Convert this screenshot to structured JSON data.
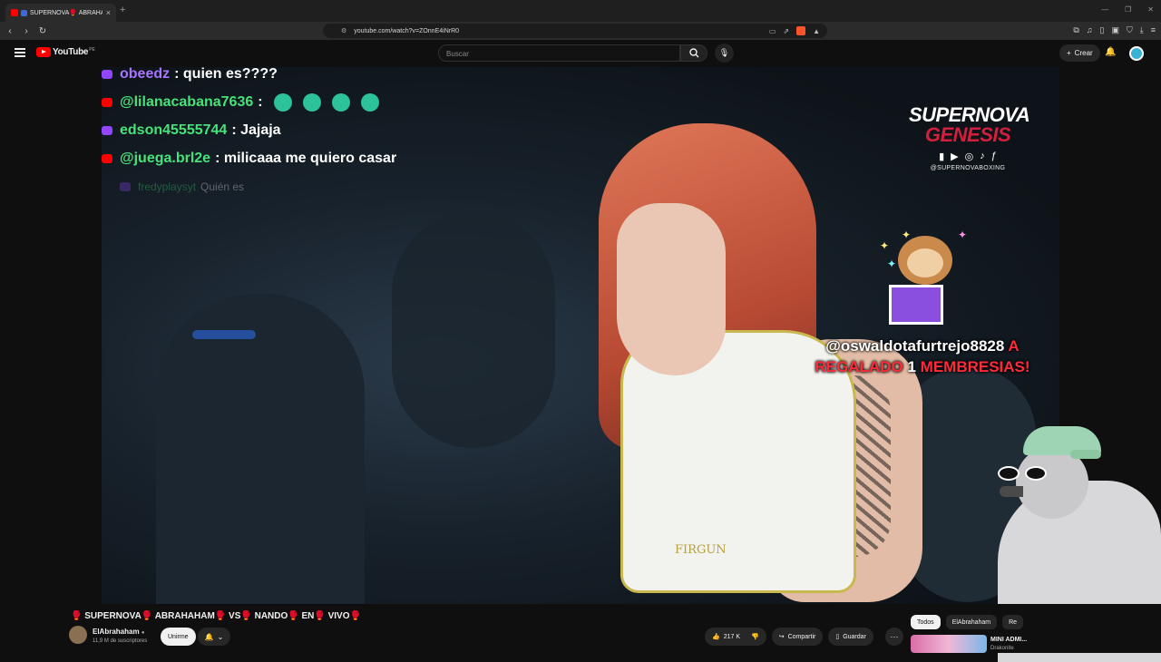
{
  "browser": {
    "tab_title": "SUPERNOVA🥊 ABRAHAH...",
    "tab_close": "×",
    "new_tab": "+",
    "url": "youtube.com/watch?v=ZOnnE4iNrR0"
  },
  "youtube": {
    "logo_text": "YouTube",
    "country_code": "PE",
    "search_placeholder": "Buscar",
    "create_label": "Crear"
  },
  "overlay": {
    "chat": [
      {
        "platform": "twitch",
        "user": "obeedz",
        "message": ": quien es????",
        "dim": false
      },
      {
        "platform": "youtube",
        "user": "@lilanacabana7636",
        "message": ":",
        "emotes": 4,
        "dim": false
      },
      {
        "platform": "twitch",
        "user": "edson45555744",
        "message": ": Jajaja",
        "dim": false
      },
      {
        "platform": "youtube",
        "user": "@juega.brl2e",
        "message": ": milicaaa me quiero casar",
        "dim": false
      },
      {
        "platform": "twitch",
        "user": "fredyplaysyt",
        "message": "Quién es",
        "dim": true
      }
    ],
    "brand_top": "SUPERNOVA",
    "brand_bottom": "GENESIS",
    "brand_handle": "@SUPERNOVABOXING",
    "alert_user": "@oswaldotafurtrejo8828",
    "alert_a": "A",
    "alert_line2_pre": "REGALADO",
    "alert_line2_num": "1",
    "alert_line2_post": "MEMBRESIAS!",
    "shorts_text": "FIRGUN"
  },
  "video_info": {
    "title": "🥊 SUPERNOVA🥊 ABRAHAHAM🥊 VS🥊 NANDO🥊 EN🥊 VIVO🥊",
    "channel": "ElAbrahaham",
    "subscribers": "11,9 M de suscriptores",
    "join_label": "Unirme",
    "likes": "217 K",
    "share_label": "Compartir",
    "save_label": "Guardar"
  },
  "sidebar": {
    "chips": [
      "Todos",
      "ElAbrahaham",
      "Re"
    ],
    "rec_title": "MINI ADMI...",
    "rec_channel": "Drakonite"
  },
  "colors": {
    "youtube_red": "#ff0000",
    "twitch_purple": "#9146ff",
    "chat_username_green": "#47e27a",
    "alert_red": "#ff2b3a"
  }
}
